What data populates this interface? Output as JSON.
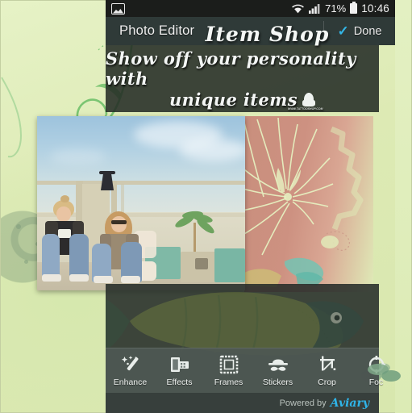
{
  "app": {
    "name": "Photo Editor",
    "background_color": "#dfecb8",
    "chrome_color": "#2f3a38",
    "accent_color": "#33b5e5"
  },
  "statusbar": {
    "left_icon": "photo-gallery-icon",
    "wifi_icon": "wifi-icon",
    "signal_icon": "cellular-signal-icon",
    "battery_percent": "71%",
    "battery_icon": "battery-icon",
    "time": "10:46"
  },
  "titlebar": {
    "title": "Photo Editor",
    "overlay_script_title": "Item Shop",
    "done_label": "Done",
    "done_check_icon": "checkmark-icon"
  },
  "promo": {
    "line1": "Show off your personality with",
    "line2": "unique items",
    "logo_icon": "tattoo-logo-icon",
    "logo_url": "WWW.TATTOOSHOP.COM"
  },
  "canvas": {
    "photo_alt": "Two women sitting outdoors against blue sky with lantern and palm tree",
    "floral_panel_alt": "Decorative lily flower illustration"
  },
  "toolbar": {
    "items": [
      {
        "label": "Enhance",
        "icon": "magic-wand-icon"
      },
      {
        "label": "Effects",
        "icon": "film-roll-icon"
      },
      {
        "label": "Frames",
        "icon": "picture-frame-icon"
      },
      {
        "label": "Stickers",
        "icon": "hat-mustache-icon"
      },
      {
        "label": "Crop",
        "icon": "crop-icon"
      },
      {
        "label": "Foc",
        "icon": "focus-target-icon"
      }
    ]
  },
  "footer": {
    "powered_by": "Powered by",
    "brand": "Aviary"
  }
}
